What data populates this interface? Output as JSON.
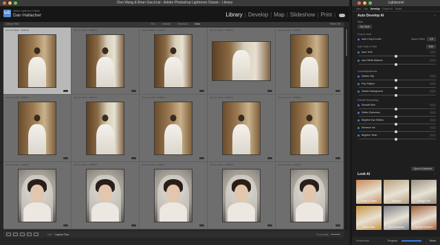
{
  "window": {
    "title": "Cleo Wang & Brian Gau.lrcat - Adobe Photoshop Lightroom Classic - Library",
    "catalog_label": "Adobe Lightroom Classic",
    "user_name": "Dan Hallacher",
    "logo_text": "LrC"
  },
  "modules": [
    {
      "label": "Library",
      "active": true
    },
    {
      "label": "Develop",
      "active": false
    },
    {
      "label": "Map",
      "active": false
    },
    {
      "label": "Slideshow",
      "active": false
    },
    {
      "label": "Print",
      "active": false
    }
  ],
  "filter_bar": {
    "label": "Library Filter :",
    "options": [
      "Text",
      "Attribute",
      "Metadata",
      "None"
    ],
    "selected": "None",
    "right_label": "Filters Off"
  },
  "grid": {
    "caption": "Cleo and Brian - 2006/26/",
    "cells": [
      {
        "scene": "room",
        "orient": "portrait",
        "selected": true
      },
      {
        "scene": "window",
        "orient": "portrait"
      },
      {
        "scene": "window",
        "orient": "portrait"
      },
      {
        "scene": "window",
        "orient": "landscape"
      },
      {
        "scene": "room",
        "orient": "portrait"
      },
      {
        "scene": "room",
        "orient": "portrait"
      },
      {
        "scene": "window",
        "orient": "portrait"
      },
      {
        "scene": "room",
        "orient": "portrait"
      },
      {
        "scene": "room",
        "orient": "portrait"
      },
      {
        "scene": "room",
        "orient": "portrait"
      },
      {
        "scene": "portrait",
        "orient": "portrait"
      },
      {
        "scene": "portrait",
        "orient": "portrait"
      },
      {
        "scene": "portrait",
        "orient": "portrait"
      },
      {
        "scene": "portrait",
        "orient": "portrait"
      },
      {
        "scene": "portrait",
        "orient": "portrait"
      }
    ]
  },
  "toolbar": {
    "sort_label": "Sort:",
    "sort_value": "Capture Time",
    "thumbnails_label": "Thumbnails"
  },
  "lightpanel": {
    "title": "Lightpanel",
    "tabs": [
      {
        "label": "Intro",
        "active": false
      },
      {
        "label": "Lab",
        "active": false
      },
      {
        "label": "Develop",
        "active": true
      },
      {
        "label": "Export AI",
        "active": false
      },
      {
        "label": "Snake",
        "active": false
      }
    ],
    "auto_develop": {
      "heading": "Auto Develop AI",
      "style_label": "Style",
      "style_value": "My Style",
      "crop_heading": "Crop & Level",
      "crop_toggle": "Auto Crop & Level",
      "aspect_label": "Aspect Ratio",
      "aspect_value": "4:5",
      "tone_heading": "Auto Tone & Color",
      "tone_button": "Edit",
      "tone_toggle": "Auto Tone",
      "wb_toggle": "Auto White Balance",
      "local_heading": "Local Adjustments",
      "local_items": [
        "Darken Sky",
        "Pop Subject",
        "Darken Background"
      ],
      "retouch_heading": "Portrait Retouching",
      "retouch_items": [
        "Smooth Skin",
        "Soften Eyebrows",
        "Brighten Eye Whites",
        "Enhance Iris",
        "Brighten Teeth"
      ],
      "sync_button": "Sync to Selected"
    },
    "look_ai": {
      "heading": "Look AI",
      "looks": [
        {
          "label": "Fresh & Clean",
          "color": "#c98a58"
        },
        {
          "label": "Highlight",
          "color": "#b7a07e"
        },
        {
          "label": "Vintage Film",
          "color": "#9a8f7f"
        },
        {
          "label": "Warm Gold",
          "color": "#c79442"
        },
        {
          "label": "Cool Monotone",
          "color": "#7d7f86"
        },
        {
          "label": "Cell Me Pumpkin",
          "color": "#a25f37"
        }
      ]
    },
    "footer": {
      "preferences": "Preferences",
      "progress_label": "Progress",
      "progress": 0.95,
      "reset": "Reset"
    }
  },
  "colors": {
    "accent": "#3c7de0",
    "selected_cell": "#b8b8b8",
    "cell": "#6e6e6e"
  }
}
